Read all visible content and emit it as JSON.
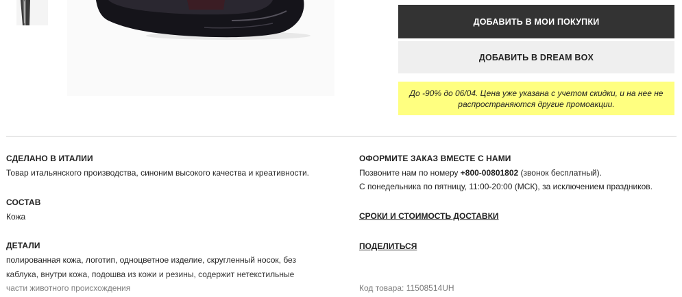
{
  "actions": {
    "add_to_cart": "ДОБАВИТЬ В МОИ ПОКУПКИ",
    "add_to_dreambox": "ДОБАВИТЬ В DREAM BOX"
  },
  "promo": {
    "line1": "До -90% до 06/04. Цена уже указана с учетом скидки, и на нее не",
    "line2": "распространяются другие промоакции."
  },
  "details": {
    "made_in": {
      "title": "СДЕЛАНО В ИТАЛИИ",
      "text": "Товар итальянского производства, синоним высокого качества и креативности."
    },
    "composition": {
      "title": "СОСТАВ",
      "text": "Кожа"
    },
    "features": {
      "title": "ДЕТАЛИ",
      "lines": [
        "полированная кожа, логотип, одноцветное изделие, скругленный носок, без",
        "каблука, внутри кожа, подошва из кожи и резины, содержит нетекстильные",
        "части животного происхождения"
      ]
    }
  },
  "contact": {
    "title": "ОФОРМИТЕ ЗАКАЗ ВМЕСТЕ С НАМИ",
    "line1_prefix": "Позвоните нам по номеру ",
    "phone": "+800-00801802",
    "line1_suffix": " (звонок бесплатный).",
    "line2": "С понедельника по пятницу, 11:00-20:00 (МСК), за исключением праздников."
  },
  "links": {
    "delivery": "СРОКИ И СТОИМОСТЬ ДОСТАВКИ",
    "share": "ПОДЕЛИТЬСЯ"
  },
  "product_code": "Код товара: 11508514UH",
  "colors": {
    "primary_button": "#333333",
    "secondary_button": "#efefef",
    "promo_background": "#ffff80"
  }
}
